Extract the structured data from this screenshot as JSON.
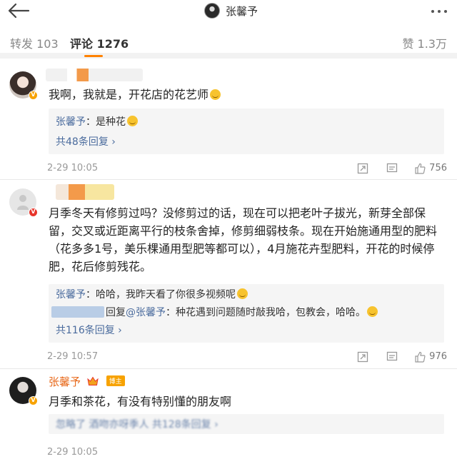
{
  "header": {
    "title": "张馨予",
    "back_icon": "back-arrow-icon",
    "more_icon": "more-dots-icon"
  },
  "tabs": {
    "repost": "转发 103",
    "comments": "评论 1276",
    "likes": "赞 1.3万"
  },
  "comments": [
    {
      "text": "我啊，我就是，开花店的花艺师",
      "reply_user": "张馨予",
      "reply_text": "：是种花",
      "more_replies": "共48条回复 ›",
      "time": "2-29 10:05",
      "likes": "756"
    },
    {
      "text": "月季冬天有修剪过吗？没修剪过的话，现在可以把老叶子拔光，新芽全部保留，交叉或近距离平行的枝条舍掉，修剪细弱枝条。现在开始施通用型的肥料（花多多1号，美乐棵通用型肥等都可以），4月施花卉型肥料，开花的时候停肥，花后修剪残花。",
      "reply_user": "张馨予",
      "reply_text": "：哈哈，我昨天看了你很多视频呢",
      "reply2_mid": "回复",
      "reply2_user": "@张馨予",
      "reply2_text": "：种花遇到问题随时敲我哈，包教会，哈哈。",
      "more_replies": "共116条回复 ›",
      "time": "2-29 10:57",
      "likes": "976"
    },
    {
      "name": "张馨予",
      "badge": "博主",
      "text": "月季和茶花，有没有特别懂的朋友啊",
      "partial_reply": "忽略了 酒吻亦呀季人  共128条回复 ›",
      "time": "2-29 10:05"
    }
  ],
  "colors": {
    "accent": "#ff8200",
    "link": "#4a6b9d",
    "muted": "#999999"
  }
}
